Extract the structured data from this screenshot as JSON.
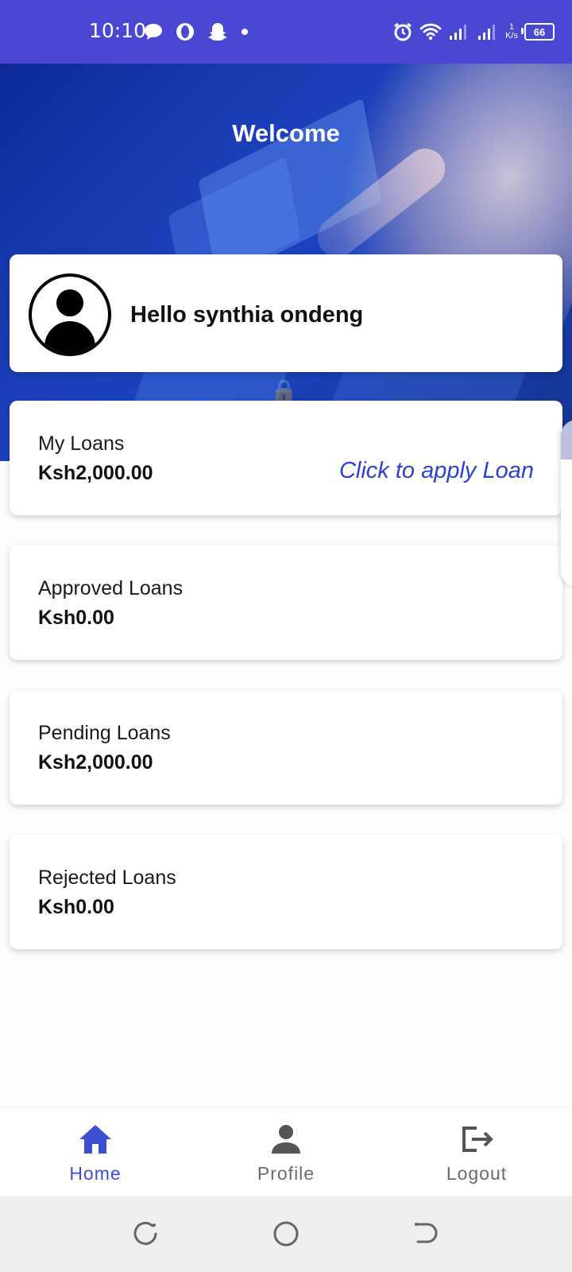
{
  "status_bar": {
    "time": "10:10",
    "speed_value": "1",
    "speed_unit": "K/s",
    "battery": "66"
  },
  "header": {
    "title": "Welcome"
  },
  "profile": {
    "greeting": "Hello synthia ondeng"
  },
  "loans": {
    "my": {
      "label": "My Loans",
      "amount": "Ksh2,000.00",
      "action": "Click to apply Loan"
    },
    "approved": {
      "label": "Approved Loans",
      "amount": "Ksh0.00"
    },
    "pending": {
      "label": "Pending Loans",
      "amount": "Ksh2,000.00"
    },
    "rejected": {
      "label": "Rejected Loans",
      "amount": "Ksh0.00"
    }
  },
  "nav": {
    "home": "Home",
    "profile": "Profile",
    "logout": "Logout"
  },
  "colors": {
    "primary": "#4a47d3",
    "accent": "#2c3fd6",
    "active_nav": "#3a4fd1",
    "inactive_nav": "#6b6b6b"
  },
  "icons": [
    "message-icon",
    "opera-icon",
    "snapchat-icon",
    "alarm-icon",
    "wifi-icon",
    "signal-icon",
    "battery-icon",
    "avatar-icon",
    "home-icon",
    "person-icon",
    "logout-icon",
    "recents-icon",
    "home-circle-icon",
    "back-icon"
  ]
}
